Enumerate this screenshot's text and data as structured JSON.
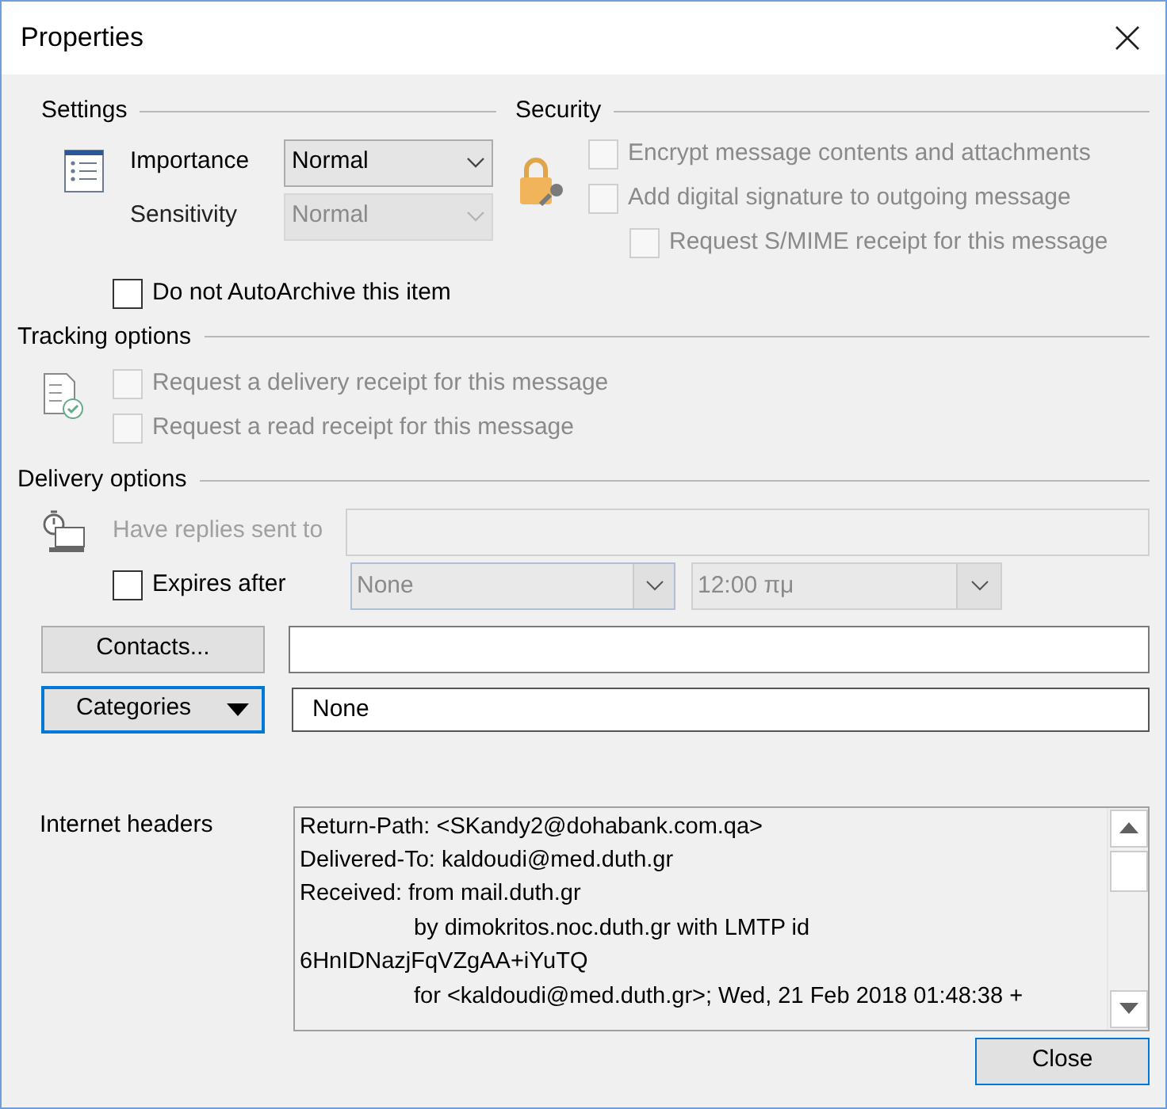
{
  "window": {
    "title": "Properties"
  },
  "settings": {
    "heading": "Settings",
    "importance": {
      "label": "Importance",
      "value": "Normal",
      "disabled": false
    },
    "sensitivity": {
      "label": "Sensitivity",
      "value": "Normal",
      "disabled": true
    },
    "autoarchive": {
      "label": "Do not AutoArchive this item",
      "checked": false,
      "disabled": false
    }
  },
  "security": {
    "heading": "Security",
    "options": [
      {
        "label": "Encrypt message contents and attachments",
        "checked": false,
        "disabled": true,
        "indented": false
      },
      {
        "label": "Add digital signature to outgoing message",
        "checked": false,
        "disabled": true,
        "indented": false
      },
      {
        "label": "Request S/MIME receipt for this message",
        "checked": false,
        "disabled": true,
        "indented": true
      }
    ]
  },
  "tracking": {
    "heading": "Tracking options",
    "options": [
      {
        "label": "Request a delivery receipt for this message",
        "checked": false,
        "disabled": true
      },
      {
        "label": "Request a read receipt for this message",
        "checked": false,
        "disabled": true
      }
    ]
  },
  "delivery": {
    "heading": "Delivery options",
    "replies": {
      "label": "Have replies sent to",
      "disabled": true
    },
    "expires": {
      "label": "Expires after",
      "checked": false,
      "disabled": false,
      "date": "None",
      "time": "12:00 πμ"
    },
    "contacts": {
      "label": "Contacts..."
    },
    "categories": {
      "label": "Categories",
      "value": "None"
    }
  },
  "headers": {
    "label": "Internet headers",
    "lines": [
      {
        "text": "Return-Path: <SKandy2@dohabank.com.qa>",
        "indented": false
      },
      {
        "text": "Delivered-To: kaldoudi@med.duth.gr",
        "indented": false
      },
      {
        "text": "Received: from mail.duth.gr",
        "indented": false
      },
      {
        "text": "by dimokritos.noc.duth.gr with LMTP id",
        "indented": true
      },
      {
        "text": "6HnIDNazjFqVZgAA+iYuTQ",
        "indented": false
      },
      {
        "text": "for <kaldoudi@med.duth.gr>; Wed, 21 Feb 2018 01:48:38 +",
        "indented": true
      }
    ]
  },
  "buttons": {
    "close": "Close"
  }
}
